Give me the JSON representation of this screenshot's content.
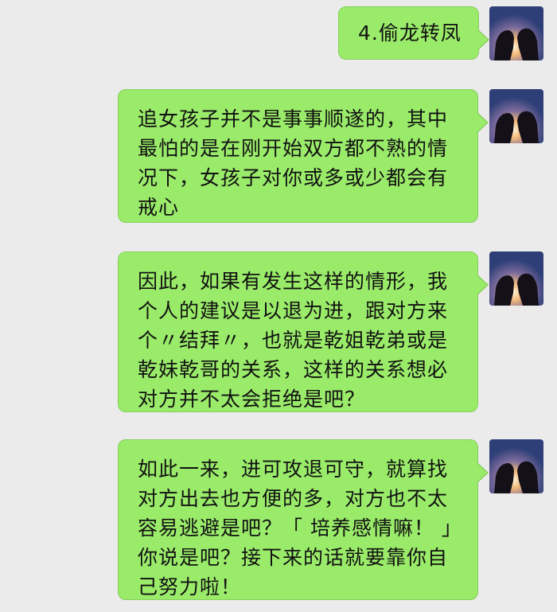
{
  "messages": [
    {
      "text": "4.偷龙转凤"
    },
    {
      "text": "追女孩子并不是事事顺遂的，其中最怕的是在刚开始双方都不熟的情况下，女孩子对你或多或少都会有戒心"
    },
    {
      "text": "因此，如果有发生这样的情形，我个人的建议是以退为进，跟对方来个〃结拜〃，也就是乾姐乾弟或是乾妹乾哥的关系，这样的关系想必对方并不太会拒绝是吧？"
    },
    {
      "text": "如此一来，进可攻退可守，就算找对方出去也方便的多，对方也不太容易逃避是吧？「 培养感情嘛！ 」你说是吧？接下来的话就要靠你自己努力啦！"
    }
  ],
  "avatar_icon": "couple-sunset-avatar",
  "colors": {
    "bubble": "#9aeb6a",
    "background": "#ebebeb"
  }
}
